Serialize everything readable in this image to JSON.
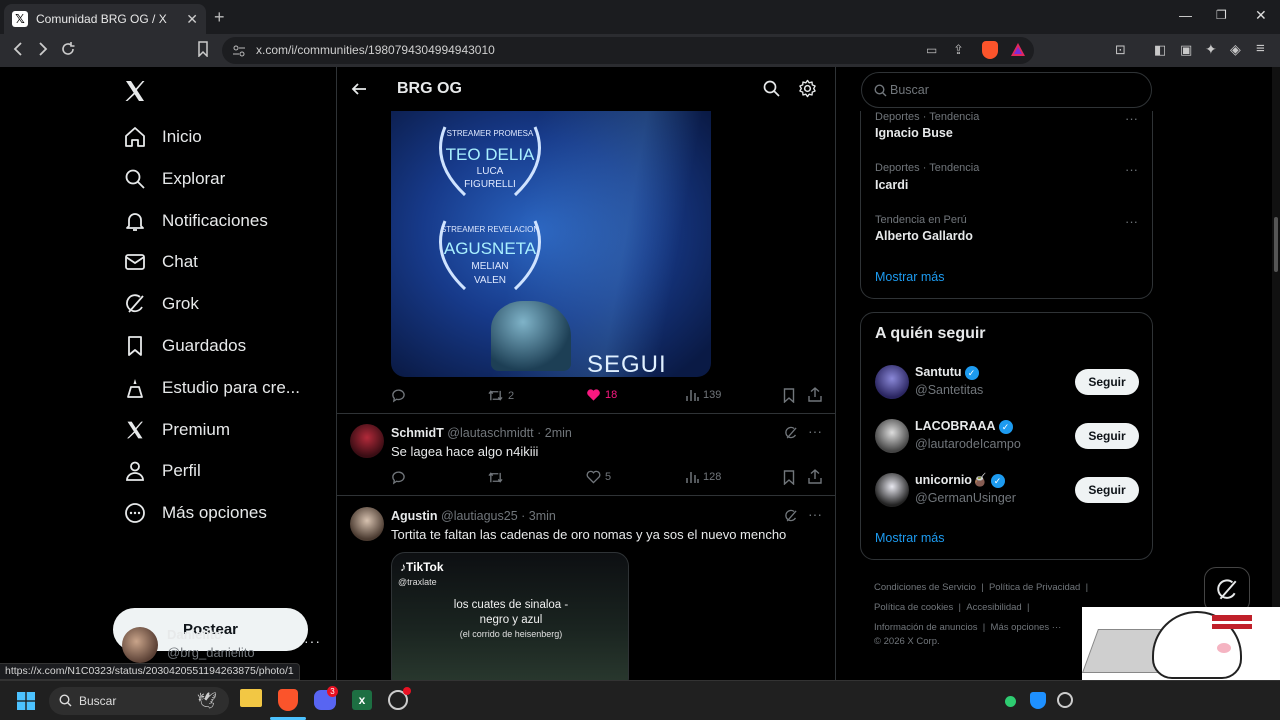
{
  "browser": {
    "tab_title": "Comunidad BRG OG / X",
    "url": "x.com/i/communities/1980794304994943010",
    "status_url": "https://x.com/N1C0323/status/2030420551194263875/photo/1"
  },
  "nav": {
    "items": [
      {
        "label": "Inicio",
        "icon": "home-icon"
      },
      {
        "label": "Explorar",
        "icon": "search-icon"
      },
      {
        "label": "Notificaciones",
        "icon": "bell-icon"
      },
      {
        "label": "Chat",
        "icon": "mail-icon"
      },
      {
        "label": "Grok",
        "icon": "grok-icon"
      },
      {
        "label": "Guardados",
        "icon": "bookmark-icon"
      },
      {
        "label": "Estudio para cre...",
        "icon": "creator-icon"
      },
      {
        "label": "Premium",
        "icon": "x-logo-icon"
      },
      {
        "label": "Perfil",
        "icon": "person-icon"
      },
      {
        "label": "Más opciones",
        "icon": "more-circle-icon"
      }
    ],
    "post_label": "Postear",
    "account": {
      "name": "Danielito",
      "handle": "@brg_danielito"
    }
  },
  "community": {
    "title": "BRG OG"
  },
  "media_overlay": {
    "l1": "STREAMER PROMESA",
    "l2": "TEO DELIA",
    "l3": "LUCA",
    "l4": "FIGURELLI",
    "l5": "STREAMER REVELACION",
    "l6": "AGUSNETA",
    "l7": "MELIAN",
    "l8": "VALEN",
    "l9": "SEGUI"
  },
  "posts": [
    {
      "retweets": "2",
      "likes": "18",
      "views": "139"
    },
    {
      "name": "SchmidT",
      "handle": "@lautaschmidtt",
      "time": "· 2min",
      "text": "Se lagea hace algo n4ikiii",
      "likes": "5",
      "views": "128"
    },
    {
      "name": "Agustin",
      "handle": "@lautiagus25",
      "time": "· 3min",
      "text": "Tortita te faltan las cadenas de oro nomas y ya sos el nuevo mencho",
      "embed": {
        "brand": "TikTok",
        "user": "@traxlate",
        "line1": "los cuates de sinaloa -",
        "line2": "negro y azul",
        "line3": "(el corrido de heisenberg)"
      }
    }
  ],
  "search": {
    "placeholder": "Buscar"
  },
  "trends": [
    {
      "meta": "Deportes · Tendencia",
      "name": "Ignacio Buse"
    },
    {
      "meta": "Deportes · Tendencia",
      "name": "Icardi"
    },
    {
      "meta": "Tendencia en Perú",
      "name": "Alberto Gallardo"
    }
  ],
  "trends_more": "Mostrar más",
  "who_to_follow": {
    "title": "A quién seguir",
    "users": [
      {
        "name": "Santutu",
        "handle": "@Santetitas",
        "button": "Seguir"
      },
      {
        "name": "LACOBRAAA",
        "handle": "@lautarodeIcampo",
        "button": "Seguir"
      },
      {
        "name": "unicornio🧉",
        "handle": "@GermanUsinger",
        "button": "Seguir"
      }
    ],
    "more": "Mostrar más"
  },
  "footer": {
    "l1a": "Condiciones de Servicio",
    "l1b": "Política de Privacidad",
    "l2a": "Política de cookies",
    "l2b": "Accesibilidad",
    "l3a": "Información de anuncios",
    "l3b": "Más opciones ···",
    "copy": "© 2026 X Corp."
  },
  "taskbar": {
    "search": "Buscar",
    "discord_badge": "3"
  },
  "colors": {
    "accent": "#1d9bf0",
    "like": "#f91880",
    "bg": "#000000",
    "border": "#2f3336"
  }
}
